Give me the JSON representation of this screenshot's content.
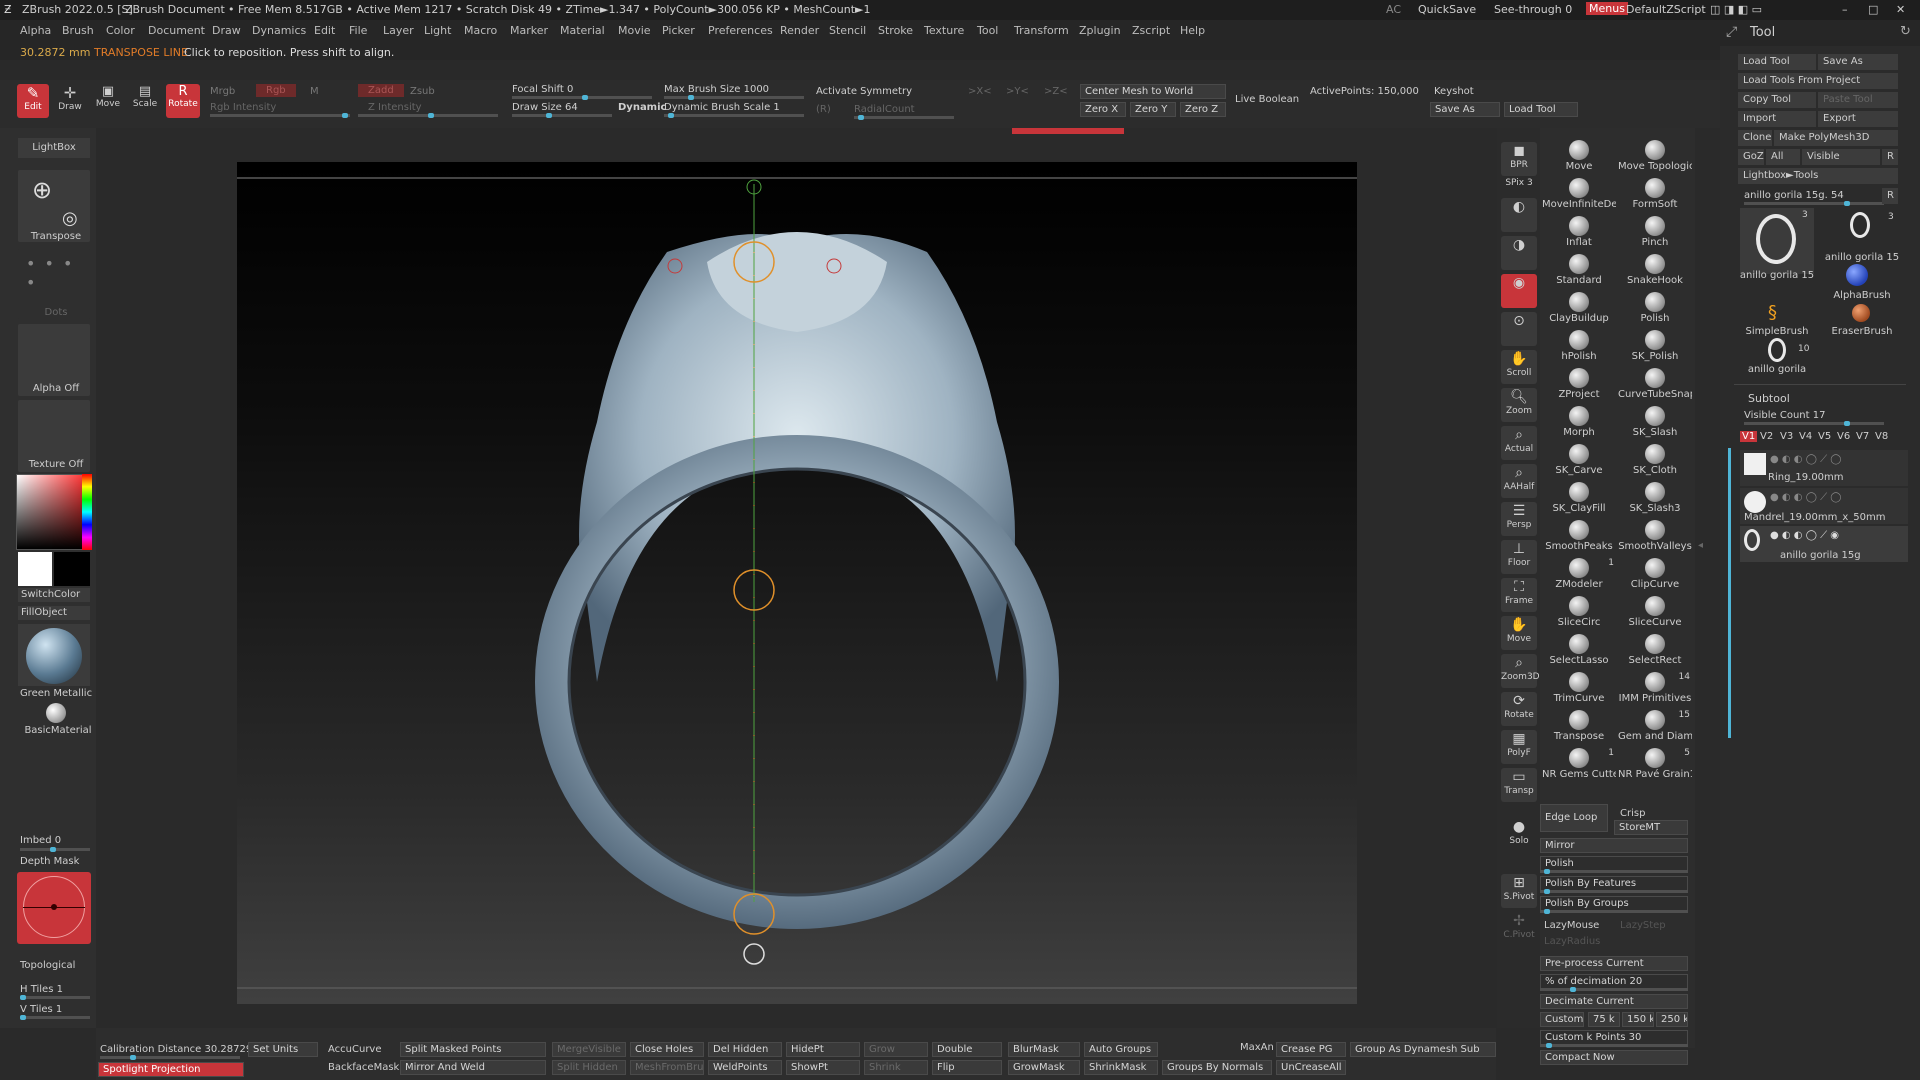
{
  "titlebar": {
    "app": "ZBrush 2022.0.5 [S]",
    "document": "ZBrush Document",
    "stats": "• Free Mem 8.517GB • Active Mem 1217 • Scratch Disk 49 • ZTime►1.347 • PolyCount►300.056 KP • MeshCount►1",
    "ac": "AC",
    "quicksave": "QuickSave",
    "seethrough": "See-through  0",
    "menus": "Menus",
    "script": "DefaultZScript"
  },
  "menubar": {
    "items": [
      "Alpha",
      "Brush",
      "Color",
      "Document",
      "Draw",
      "Dynamics",
      "Edit",
      "File",
      "Layer",
      "Light",
      "Macro",
      "Marker",
      "Material",
      "Movie",
      "Picker",
      "Preferences",
      "Render",
      "Stencil",
      "Stroke",
      "Texture",
      "Tool",
      "Transform",
      "Zplugin",
      "Zscript",
      "Help"
    ]
  },
  "statusline": {
    "measure": "30.2872 mm",
    "mode": "TRANSPOSE LINE",
    "hint": "Click to reposition. Press shift to align."
  },
  "toolbar": {
    "edit": "Edit",
    "draw": "Draw",
    "move": "Move",
    "scale": "Scale",
    "rotate": "Rotate",
    "mrgb": "Mrgb",
    "rgb": "Rgb",
    "m": "M",
    "zadd": "Zadd",
    "zsub": "Zsub",
    "rgb_intensity": "Rgb Intensity",
    "z_intensity": "Z Intensity",
    "focal_shift": "Focal Shift 0",
    "draw_size": "Draw Size 64",
    "dynamic": "Dynamic",
    "max_brush_size": "Max Brush Size 1000",
    "dynamic_brush_scale": "Dynamic Brush Scale 1",
    "activate_symmetry": "Activate Symmetry",
    "x": ">X<",
    "y": ">Y<",
    "z": ">Z<",
    "r": "(R)",
    "radial_count": "RadialCount",
    "center_mesh": "Center Mesh to World",
    "zero_x": "Zero X",
    "zero_y": "Zero Y",
    "zero_z": "Zero Z",
    "live_boolean": "Live Boolean",
    "active_points": "ActivePoints: 150,000",
    "keyshot": "Keyshot",
    "save_as": "Save As",
    "load_tool": "Load Tool"
  },
  "leftshelf": {
    "lightbox": "LightBox",
    "transpose": "Transpose",
    "dots": "Dots",
    "alpha": "Alpha Off",
    "texture": "Texture Off",
    "switchcolor": "SwitchColor",
    "fillobject": "FillObject",
    "material1": "Green Metallic",
    "material2": "BasicMaterial",
    "imbed": "Imbed 0",
    "depth_mask": "Depth Mask",
    "topological": "Topological",
    "h_tiles": "H Tiles 1",
    "v_tiles": "V Tiles 1"
  },
  "rightshelf": {
    "items": [
      "BPR",
      "SPix 3",
      "",
      "",
      "",
      "",
      "Scroll",
      "Zoom",
      "Actual",
      "AAHalf",
      "Persp",
      "Floor",
      "Frame",
      "Move",
      "Zoom3D",
      "Rotate",
      "PolyF",
      "Transp",
      "Solo",
      "S.Pivot",
      "C.Pivot"
    ]
  },
  "brushes": [
    [
      "Move",
      "Move Topologic"
    ],
    [
      "MoveInfiniteDe",
      "FormSoft"
    ],
    [
      "Inflat",
      "Pinch"
    ],
    [
      "Standard",
      "SnakeHook"
    ],
    [
      "ClayBuildup",
      "Polish"
    ],
    [
      "hPolish",
      "SK_Polish"
    ],
    [
      "ZProject",
      "CurveTubeSnap"
    ],
    [
      "Morph",
      "SK_Slash"
    ],
    [
      "SK_Carve",
      "SK_Cloth"
    ],
    [
      "SK_ClayFill",
      "SK_Slash3"
    ],
    [
      "SmoothPeaks",
      "SmoothValleys"
    ],
    [
      "ZModeler",
      "ClipCurve"
    ],
    [
      "SliceCirc",
      "SliceCurve"
    ],
    [
      "SelectLasso",
      "SelectRect"
    ],
    [
      "TrimCurve",
      "IMM Primitives"
    ],
    [
      "Transpose",
      "Gem and Diamo"
    ],
    [
      "NR Gems Cutte",
      "NR Pavé Grain1"
    ]
  ],
  "brush_badges": {
    "zmodeler": "1",
    "imm": "14",
    "gem": "15",
    "nrgems": "1",
    "nrpave": "5"
  },
  "deformation": {
    "edge_loop": "Edge Loop",
    "crisp": "Crisp",
    "storemt": "StoreMT",
    "mirror": "Mirror",
    "polish": "Polish",
    "polish_features": "Polish By Features",
    "polish_groups": "Polish By Groups",
    "lazymouse": "LazyMouse",
    "lazystep": "LazyStep",
    "lazyradius": "LazyRadius",
    "preprocess": "Pre-process Current",
    "decimation": "% of decimation 20",
    "decimate": "Decimate Current",
    "custom": "Custom",
    "k75": "75 k",
    "k150": "150 k",
    "k250": "250 k",
    "custom_k": "Custom k Points 30",
    "compact": "Compact Now"
  },
  "toolpanel": {
    "title": "Tool",
    "load_tool": "Load Tool",
    "save_as": "Save As",
    "load_from_project": "Load Tools From Project",
    "copy_tool": "Copy Tool",
    "paste_tool": "Paste Tool",
    "import": "Import",
    "export": "Export",
    "clone": "Clone",
    "make_polymesh": "Make PolyMesh3D",
    "goz": "GoZ",
    "all": "All",
    "visible": "Visible",
    "r": "R",
    "lightbox_tools": "Lightbox►Tools",
    "current_tool": "anillo gorila 15g. 54",
    "thumbs": [
      {
        "name": "anillo gorila 15",
        "count": "3"
      },
      {
        "name": "anillo gorila 15",
        "count": "3"
      },
      {
        "name": "AlphaBrush",
        "count": ""
      },
      {
        "name": "SimpleBrush",
        "count": ""
      },
      {
        "name": "EraserBrush",
        "count": ""
      },
      {
        "name": "anillo gorila",
        "count": "10"
      }
    ],
    "subtool": "Subtool",
    "visible_count": "Visible Count 17",
    "versions": [
      "V1",
      "V2",
      "V3",
      "V4",
      "V5",
      "V6",
      "V7",
      "V8"
    ],
    "subtools": [
      "Ring_19.00mm",
      "Mandrel_19.00mm_x_50mm",
      "anillo gorila 15g"
    ]
  },
  "bottombar": {
    "calibration": "Calibration Distance 30.28729",
    "set_units": "Set Units",
    "spotlight": "Spotlight Projection",
    "accucurve": "AccuCurve",
    "backfacemask": "BackfaceMask",
    "split_masked": "Split Masked Points",
    "mirror_weld": "Mirror And Weld",
    "mergevisible": "MergeVisible",
    "split_hidden": "Split Hidden",
    "close_holes": "Close Holes",
    "meshfrombrush": "MeshFromBru",
    "del_hidden": "Del Hidden",
    "weldpoints": "WeldPoints",
    "hidept": "HidePt",
    "showpt": "ShowPt",
    "grow": "Grow",
    "shrink": "Shrink",
    "double": "Double",
    "flip": "Flip",
    "blurmask": "BlurMask",
    "growmask": "GrowMask",
    "auto_groups": "Auto Groups",
    "shrinkmask": "ShrinkMask",
    "groups_normals": "Groups By Normals",
    "maxangle": "MaxAn",
    "crease_pg": "Crease PG",
    "uncreaseall": "UnCreaseAll",
    "group_dynamesh": "Group As Dynamesh Sub"
  },
  "colors": {
    "accent": "#4fb5d6",
    "active_red": "#d9403b",
    "ring": "#aebfc9",
    "guide_orange": "#e0902a"
  }
}
